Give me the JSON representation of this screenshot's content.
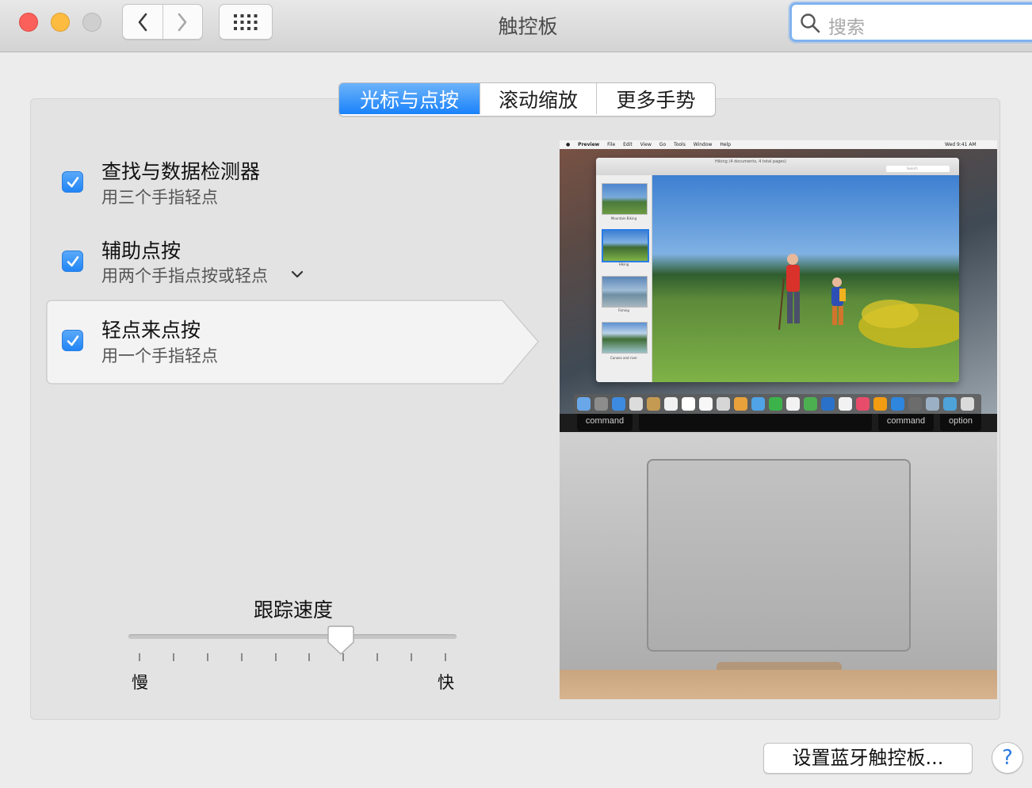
{
  "window": {
    "title": "触控板"
  },
  "search": {
    "placeholder": "搜索"
  },
  "tabs": [
    {
      "label": "光标与点按",
      "active": true
    },
    {
      "label": "滚动缩放",
      "active": false
    },
    {
      "label": "更多手势",
      "active": false
    }
  ],
  "options": [
    {
      "title": "查找与数据检测器",
      "subtitle": "用三个手指轻点",
      "checked": true,
      "has_dropdown": false
    },
    {
      "title": "辅助点按",
      "subtitle": "用两个手指点按或轻点",
      "checked": true,
      "has_dropdown": true
    },
    {
      "title": "轻点来点按",
      "subtitle": "用一个手指轻点",
      "checked": true,
      "has_dropdown": false,
      "selected": true
    }
  ],
  "tracking_speed": {
    "label": "跟踪速度",
    "min_label": "慢",
    "max_label": "快",
    "value": 0.66,
    "tick_count": 10
  },
  "preview": {
    "menubar": [
      "Preview",
      "File",
      "Edit",
      "View",
      "Go",
      "Tools",
      "Window",
      "Help"
    ],
    "menubar_clock": "Wed 9:41 AM",
    "window_title": "Hiking (4 documents, 4 total pages)",
    "search_placeholder": "Search",
    "thumbnails": [
      "Mountain Biking",
      "Hiking",
      "Fishing",
      "Canoes and river"
    ],
    "keys": [
      "command",
      "command",
      "option"
    ]
  },
  "buttons": {
    "bluetooth": "设置蓝牙触控板...",
    "help": "?"
  },
  "colors": {
    "accent": "#1a82fb",
    "checkbox": "#2185f6",
    "help_text": "#2b7be4"
  }
}
